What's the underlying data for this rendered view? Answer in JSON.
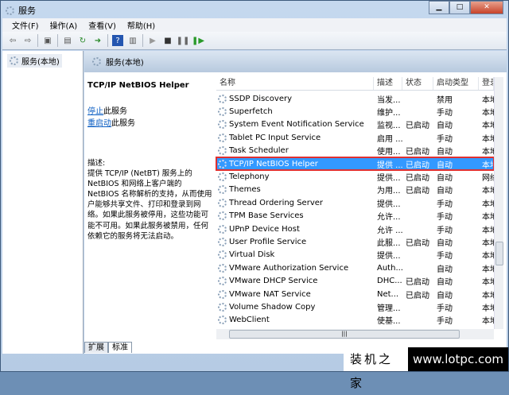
{
  "window": {
    "title": "服务"
  },
  "menu": [
    "文件(F)",
    "操作(A)",
    "查看(V)",
    "帮助(H)"
  ],
  "tree": {
    "root": "服务(本地)"
  },
  "band": {
    "title": "服务(本地)"
  },
  "detail": {
    "title": "TCP/IP NetBIOS Helper",
    "stop_link": "停止",
    "stop_suffix": "此服务",
    "restart_link": "重启动",
    "restart_suffix": "此服务",
    "desc_label": "描述:",
    "desc": "提供 TCP/IP (NetBT) 服务上的 NetBIOS 和网络上客户端的 NetBIOS 名称解析的支持，从而使用户能够共享文件、打印和登录到网络。如果此服务被停用，这些功能可能不可用。如果此服务被禁用，任何依赖它的服务将无法启动。"
  },
  "columns": [
    "名称",
    "描述",
    "状态",
    "启动类型",
    "登录为"
  ],
  "rows": [
    {
      "name": "SSDP Discovery",
      "desc": "当发...",
      "status": "",
      "startup": "禁用",
      "logon": "本地"
    },
    {
      "name": "Superfetch",
      "desc": "维护...",
      "status": "",
      "startup": "手动",
      "logon": "本地"
    },
    {
      "name": "System Event Notification Service",
      "desc": "监视...",
      "status": "已启动",
      "startup": "自动",
      "logon": "本地"
    },
    {
      "name": "Tablet PC Input Service",
      "desc": "启用 ...",
      "status": "",
      "startup": "手动",
      "logon": "本地"
    },
    {
      "name": "Task Scheduler",
      "desc": "使用...",
      "status": "已启动",
      "startup": "自动",
      "logon": "本地"
    },
    {
      "name": "TCP/IP NetBIOS Helper",
      "desc": "提供 ...",
      "status": "已启动",
      "startup": "自动",
      "logon": "本地",
      "selected": true
    },
    {
      "name": "Telephony",
      "desc": "提供...",
      "status": "已启动",
      "startup": "自动",
      "logon": "网络"
    },
    {
      "name": "Themes",
      "desc": "为用...",
      "status": "已启动",
      "startup": "自动",
      "logon": "本地"
    },
    {
      "name": "Thread Ordering Server",
      "desc": "提供...",
      "status": "",
      "startup": "手动",
      "logon": "本地"
    },
    {
      "name": "TPM Base Services",
      "desc": "允许...",
      "status": "",
      "startup": "手动",
      "logon": "本地"
    },
    {
      "name": "UPnP Device Host",
      "desc": "允许 ...",
      "status": "",
      "startup": "手动",
      "logon": "本地"
    },
    {
      "name": "User Profile Service",
      "desc": "此服...",
      "status": "已启动",
      "startup": "自动",
      "logon": "本地"
    },
    {
      "name": "Virtual Disk",
      "desc": "提供...",
      "status": "",
      "startup": "手动",
      "logon": "本地"
    },
    {
      "name": "VMware Authorization Service",
      "desc": "Auth...",
      "status": "",
      "startup": "自动",
      "logon": "本地"
    },
    {
      "name": "VMware DHCP Service",
      "desc": "DHC...",
      "status": "已启动",
      "startup": "自动",
      "logon": "本地"
    },
    {
      "name": "VMware NAT Service",
      "desc": "Net...",
      "status": "已启动",
      "startup": "自动",
      "logon": "本地"
    },
    {
      "name": "Volume Shadow Copy",
      "desc": "管理...",
      "status": "",
      "startup": "手动",
      "logon": "本地"
    },
    {
      "name": "WebClient",
      "desc": "使基...",
      "status": "",
      "startup": "手动",
      "logon": "本地"
    }
  ],
  "tabs": [
    "扩展",
    "标准"
  ],
  "watermark": {
    "cn": "装机之家",
    "url": "www.lotpc.com"
  }
}
